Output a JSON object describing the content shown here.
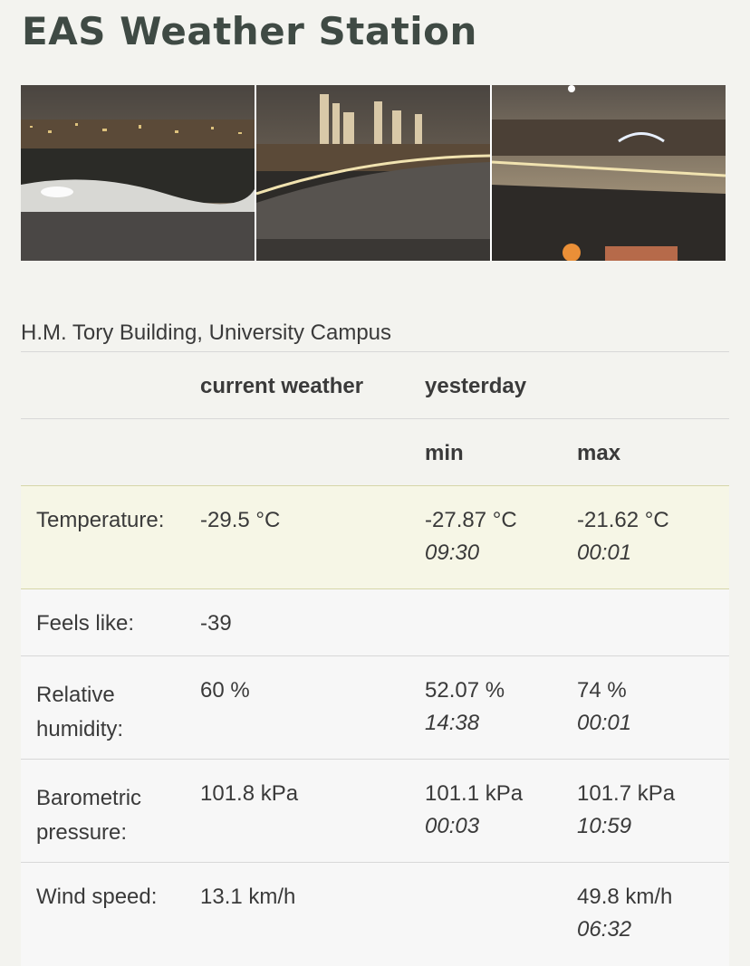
{
  "page": {
    "title": "EAS Weather Station"
  },
  "location": "H.M. Tory Building, University Campus",
  "table": {
    "headers": {
      "label": "",
      "current": "current weather",
      "yesterday": "yesterday"
    },
    "subheaders": {
      "min": "min",
      "max": "max"
    },
    "rows": [
      {
        "label": "Temperature:",
        "current": "-29.5 °C",
        "min": "-27.87 °C",
        "min_time": "09:30",
        "max": "-21.62 °C",
        "max_time": "00:01"
      },
      {
        "label": "Feels like:",
        "current": "-39",
        "min": "",
        "min_time": "",
        "max": "",
        "max_time": ""
      },
      {
        "label": "Relative humidity:",
        "current": "60 %",
        "min": "52.07 %",
        "min_time": "14:38",
        "max": "74 %",
        "max_time": "00:01"
      },
      {
        "label": "Barometric pressure:",
        "current": "101.8 kPa",
        "min": "101.1 kPa",
        "min_time": "00:03",
        "max": "101.7 kPa",
        "max_time": "10:59"
      },
      {
        "label": "Wind speed:",
        "current": "13.1 km/h",
        "min": "",
        "min_time": "",
        "max": "49.8 km/h",
        "max_time": "06:32"
      }
    ]
  },
  "colors": {
    "title": "#3f4a44",
    "highlight_row": "#f6f6e6",
    "row_bg": "#f7f7f7"
  }
}
